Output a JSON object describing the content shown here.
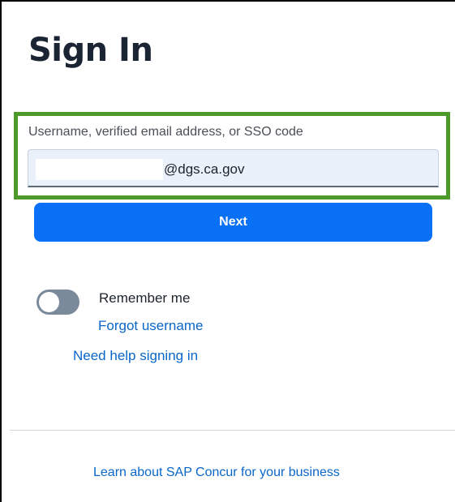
{
  "page": {
    "title": "Sign In"
  },
  "form": {
    "username_label": "Username, verified email address, or SSO code",
    "username_value": "@dgs.ca.gov",
    "next_label": "Next"
  },
  "options": {
    "remember_label": "Remember me",
    "remember_on": false,
    "forgot_username": "Forgot username",
    "need_help": "Need help signing in"
  },
  "footer": {
    "learn_link": "Learn about SAP Concur for your business"
  },
  "colors": {
    "highlight": "#4c9a2a",
    "primary_button": "#0a70f5",
    "link": "#0a66c9",
    "toggle_off": "#7b8a9b",
    "heading": "#1a2433"
  }
}
